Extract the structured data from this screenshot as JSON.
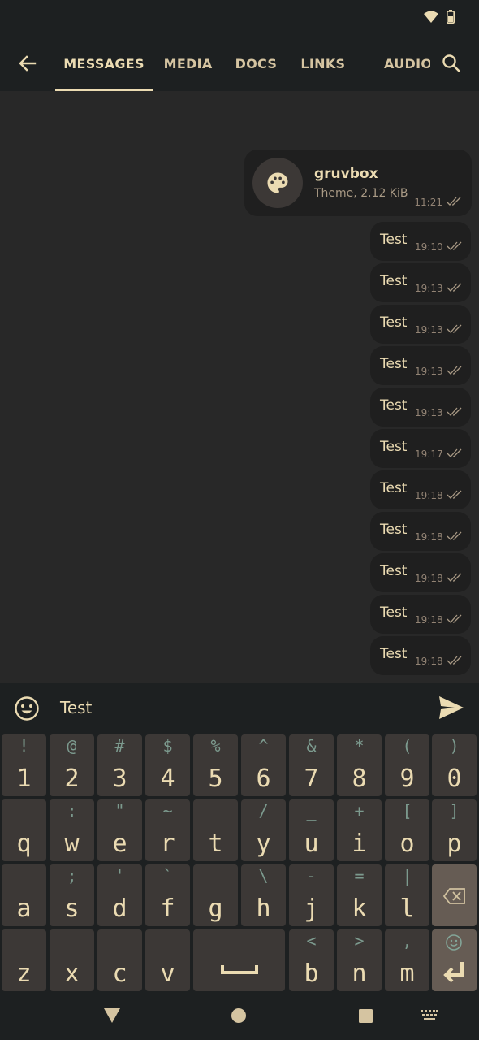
{
  "tabs": [
    "MESSAGES",
    "MEDIA",
    "DOCS",
    "LINKS",
    "AUDIO"
  ],
  "active_tab": 0,
  "file": {
    "name": "gruvbox",
    "meta": "Theme, 2.12 KiB",
    "time": "11:21",
    "icon": "palette-icon"
  },
  "messages": [
    {
      "text": "Test",
      "time": "19:10"
    },
    {
      "text": "Test",
      "time": "19:13"
    },
    {
      "text": "Test",
      "time": "19:13"
    },
    {
      "text": "Test",
      "time": "19:13"
    },
    {
      "text": "Test",
      "time": "19:13"
    },
    {
      "text": "Test",
      "time": "19:17"
    },
    {
      "text": "Test",
      "time": "19:18"
    },
    {
      "text": "Test",
      "time": "19:18"
    },
    {
      "text": "Test",
      "time": "19:18"
    },
    {
      "text": "Test",
      "time": "19:18"
    },
    {
      "text": "Test",
      "time": "19:18"
    }
  ],
  "input": {
    "value": "Test"
  },
  "keyboard": {
    "rows": [
      [
        [
          "1",
          "!"
        ],
        [
          "2",
          "@"
        ],
        [
          "3",
          "#"
        ],
        [
          "4",
          "$"
        ],
        [
          "5",
          "%"
        ],
        [
          "6",
          "^"
        ],
        [
          "7",
          "&"
        ],
        [
          "8",
          "*"
        ],
        [
          "9",
          "("
        ],
        [
          "0",
          ")"
        ]
      ],
      [
        [
          "q",
          ""
        ],
        [
          "w",
          ":"
        ],
        [
          "e",
          "\""
        ],
        [
          "r",
          "~"
        ],
        [
          "t",
          ""
        ],
        [
          "y",
          "/"
        ],
        [
          "u",
          "_"
        ],
        [
          "i",
          "+"
        ],
        [
          "o",
          "["
        ],
        [
          "p",
          "]"
        ]
      ],
      [
        [
          "a",
          ""
        ],
        [
          "s",
          ";"
        ],
        [
          "d",
          "'"
        ],
        [
          "f",
          "`"
        ],
        [
          "g",
          ""
        ],
        [
          "h",
          "\\"
        ],
        [
          "j",
          "-"
        ],
        [
          "k",
          "="
        ],
        [
          "l",
          "|"
        ]
      ],
      [
        [
          "z",
          ""
        ],
        [
          "x",
          ""
        ],
        [
          "c",
          ""
        ],
        [
          "v",
          ""
        ],
        [
          "b",
          "<"
        ],
        [
          "n",
          ">"
        ],
        [
          "m",
          ","
        ]
      ]
    ]
  },
  "colors": {
    "bg": "#282828",
    "bar": "#1d2021",
    "fg": "#ebdbb2",
    "accent": "#83a598",
    "key": "#3c3836"
  }
}
